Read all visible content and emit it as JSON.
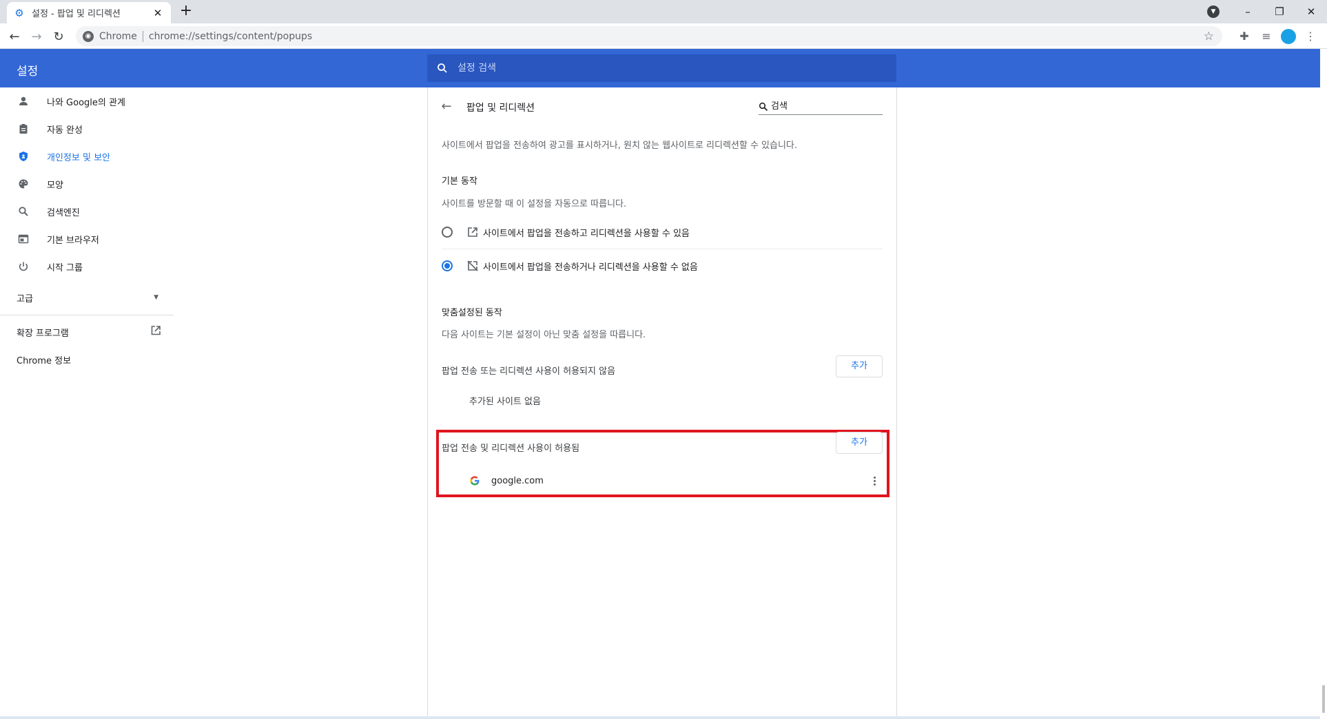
{
  "browser": {
    "tab_title": "설정 - 팝업 및 리디렉션",
    "tab_close": "✕",
    "new_tab": "+",
    "omnibox_chip": "Chrome",
    "url": "chrome://settings/content/popups"
  },
  "settings": {
    "header_title": "설정",
    "search_placeholder": "설정 검색",
    "nav": [
      {
        "label": "나와 Google의 관계",
        "icon": "person-icon"
      },
      {
        "label": "자동 완성",
        "icon": "clipboard-icon"
      },
      {
        "label": "개인정보 및 보안",
        "icon": "shield-icon",
        "active": true
      },
      {
        "label": "모양",
        "icon": "palette-icon"
      },
      {
        "label": "검색엔진",
        "icon": "search-icon"
      },
      {
        "label": "기본 브라우저",
        "icon": "browser-icon"
      },
      {
        "label": "시작 그룹",
        "icon": "power-icon"
      }
    ],
    "advanced_label": "고급",
    "extensions_label": "확장 프로그램",
    "about_label": "Chrome 정보"
  },
  "page": {
    "title": "팝업 및 리디렉션",
    "search_placeholder": "검색",
    "description": "사이트에서 팝업을 전송하여 광고를 표시하거나, 원치 않는 웹사이트로 리디렉션할 수 있습니다.",
    "default_heading": "기본 동작",
    "default_sub": "사이트를 방문할 때 이 설정을 자동으로 따릅니다.",
    "option_allow": "사이트에서 팝업을 전송하고 리디렉션을 사용할 수 있음",
    "option_block": "사이트에서 팝업을 전송하거나 리디렉션을 사용할 수 없음",
    "selected_option": "block",
    "custom_heading": "맞춤설정된 동작",
    "custom_sub": "다음 사이트는 기본 설정이 아닌 맞춤 설정을 따릅니다.",
    "blocked_heading": "팝업 전송 또는 리디렉션 사용이 허용되지 않음",
    "blocked_empty": "추가된 사이트 없음",
    "allowed_heading": "팝업 전송 및 리디렉션 사용이 허용됨",
    "add_label": "추가",
    "allowed_sites": [
      "google.com"
    ]
  },
  "colors": {
    "header_blue": "#3367d6",
    "accent": "#1a73e8",
    "highlight_red": "#e0141e"
  }
}
